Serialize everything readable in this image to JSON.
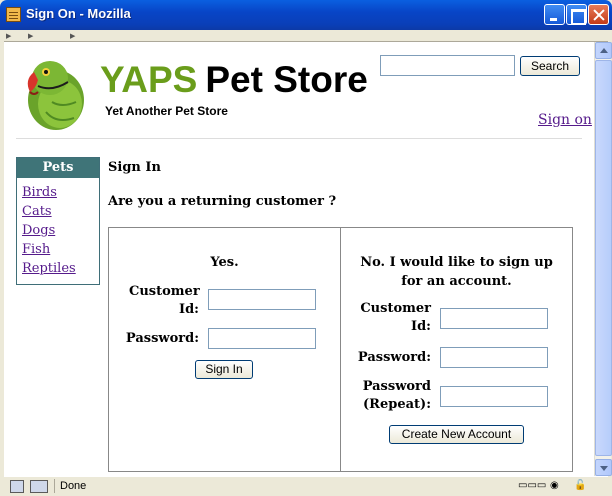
{
  "window": {
    "title": "Sign On - Mozilla"
  },
  "header": {
    "brand_yaps": "YAPS",
    "brand_store": "Pet Store",
    "tagline": "Yet Another Pet Store",
    "search_value": "",
    "search_button": "Search",
    "sign_on_link": "Sign on"
  },
  "sidebar": {
    "title": "Pets",
    "items": [
      {
        "label": "Birds"
      },
      {
        "label": "Cats"
      },
      {
        "label": "Dogs"
      },
      {
        "label": "Fish"
      },
      {
        "label": "Reptiles"
      }
    ]
  },
  "main": {
    "heading": "Sign In",
    "question": "Are you a returning customer ?",
    "returning": {
      "title": "Yes.",
      "customer_id_label_1": "Customer",
      "customer_id_label_2": "Id:",
      "customer_id_value": "",
      "password_label": "Password:",
      "password_value": "",
      "submit_label": "Sign In"
    },
    "new_account": {
      "title_1": "No. I would like to sign up",
      "title_2": "for an account.",
      "customer_id_label_1": "Customer",
      "customer_id_label_2": "Id:",
      "customer_id_value": "",
      "password_label": "Password:",
      "password_value": "",
      "repeat_label_1": "Password",
      "repeat_label_2": "(Repeat):",
      "repeat_value": "",
      "submit_label": "Create New Account"
    }
  },
  "status": {
    "text": "Done"
  },
  "colors": {
    "brand_green": "#6a9d1b",
    "sidebar_header": "#3f7478",
    "visited_link": "#551a8b",
    "titlebar_blue": "#0845c7"
  }
}
